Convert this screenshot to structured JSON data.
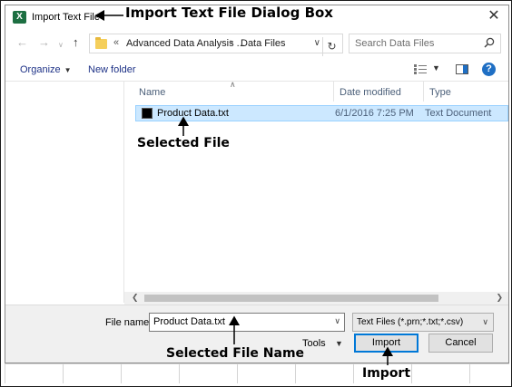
{
  "dialog": {
    "title": "Import Text File",
    "app_icon": "excel-icon",
    "close_icon": "close-icon"
  },
  "navigation": {
    "breadcrumb_overflow": "«",
    "breadcrumbs": [
      "Advanced Data Analysis ...",
      "Data Files"
    ],
    "crumb_separator": "›",
    "search_placeholder": "Search Data Files"
  },
  "toolbar": {
    "organize_label": "Organize",
    "new_folder_label": "New folder",
    "help_label": "?"
  },
  "file_list": {
    "columns": [
      "Name",
      "Date modified",
      "Type"
    ],
    "files": [
      {
        "name": "Product Data.txt",
        "date_modified": "6/1/2016 7:25 PM",
        "type": "Text Document"
      }
    ]
  },
  "footer": {
    "file_name_label": "File name:",
    "file_name_value": "Product Data.txt",
    "file_type_value": "Text Files (*.prn;*.txt;*.csv)",
    "tools_label": "Tools",
    "import_label": "Import",
    "cancel_label": "Cancel"
  },
  "annotations": {
    "title_note": "Import Text File Dialog Box",
    "selected_file_note": "Selected File",
    "selected_file_name_note": "Selected File Name",
    "import_note": "Import"
  },
  "colors": {
    "selection_fill": "#cce8ff",
    "selection_border": "#99d1ff",
    "accent_blue": "#0078d7",
    "excel_green": "#1d6f42"
  }
}
